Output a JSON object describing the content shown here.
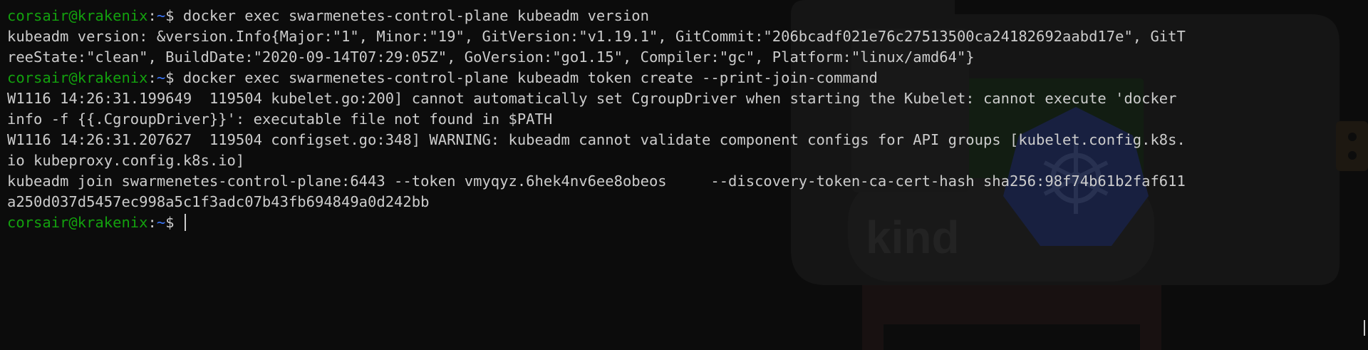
{
  "prompt": {
    "user": "corsair@krakenix",
    "separator": ":",
    "path": "~",
    "symbol": "$ "
  },
  "commands": [
    "docker exec swarmenetes-control-plane kubeadm version",
    "docker exec swarmenetes-control-plane kubeadm token create --print-join-command"
  ],
  "output": [
    "kubeadm version: &version.Info{Major:\"1\", Minor:\"19\", GitVersion:\"v1.19.1\", GitCommit:\"206bcadf021e76c27513500ca24182692aabd17e\", GitT",
    "reeState:\"clean\", BuildDate:\"2020-09-14T07:29:05Z\", GoVersion:\"go1.15\", Compiler:\"gc\", Platform:\"linux/amd64\"}",
    "W1116 14:26:31.199649  119504 kubelet.go:200] cannot automatically set CgroupDriver when starting the Kubelet: cannot execute 'docker",
    "info -f {{.CgroupDriver}}': executable file not found in $PATH",
    "W1116 14:26:31.207627  119504 configset.go:348] WARNING: kubeadm cannot validate component configs for API groups [kubelet.config.k8s.",
    "io kubeproxy.config.k8s.io]",
    "kubeadm join swarmenetes-control-plane:6443 --token vmyqyz.6hek4nv6ee8obeos     --discovery-token-ca-cert-hash sha256:98f74b61b2faf611",
    "a250d037d5457ec998a5c1f3adc07b43fb694849a0d242bb"
  ],
  "watermark": {
    "text": "kind",
    "icon": "kubernetes-helm-icon"
  },
  "colors": {
    "background": "#0c0c0c",
    "user": "#13a10e",
    "path": "#3b78ff",
    "text": "#cccccc"
  }
}
